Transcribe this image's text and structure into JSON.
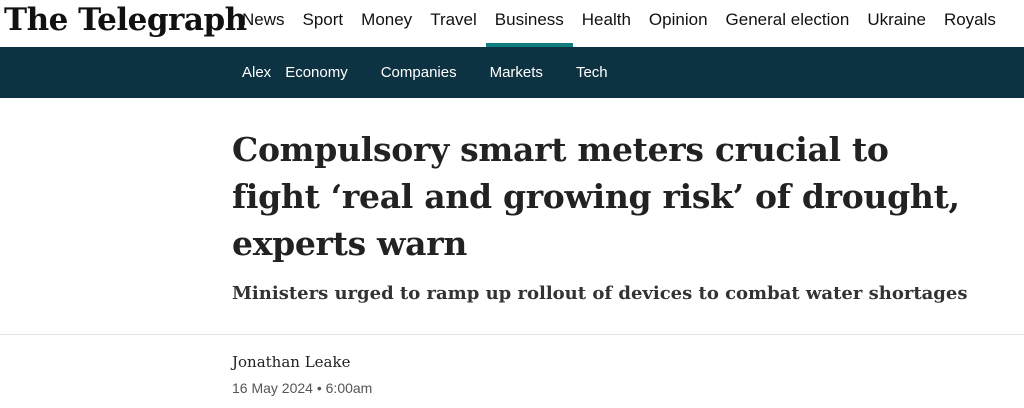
{
  "brand": {
    "logo_text": "The Telegraph"
  },
  "main_nav": {
    "items": [
      {
        "label": "News"
      },
      {
        "label": "Sport"
      },
      {
        "label": "Money"
      },
      {
        "label": "Travel"
      },
      {
        "label": "Business",
        "active": true
      },
      {
        "label": "Health"
      },
      {
        "label": "Opinion"
      },
      {
        "label": "General election"
      },
      {
        "label": "Ukraine"
      },
      {
        "label": "Royals"
      }
    ]
  },
  "section_nav": {
    "items": [
      {
        "label": "Alex"
      },
      {
        "label": "Economy"
      },
      {
        "label": "Companies"
      },
      {
        "label": "Markets"
      },
      {
        "label": "Tech"
      }
    ]
  },
  "article": {
    "headline": "Compulsory smart meters crucial to fight ‘real and growing risk’ of drought, experts warn",
    "standfirst": "Ministers urged to ramp up rollout of devices to combat water shortages",
    "author": "Jonathan Leake",
    "date": "16 May 2024",
    "time": "6:00am",
    "date_separator": "•"
  },
  "colors": {
    "section_bar": "#0d3242",
    "active_underline": "#117e80",
    "text": "#222222"
  }
}
